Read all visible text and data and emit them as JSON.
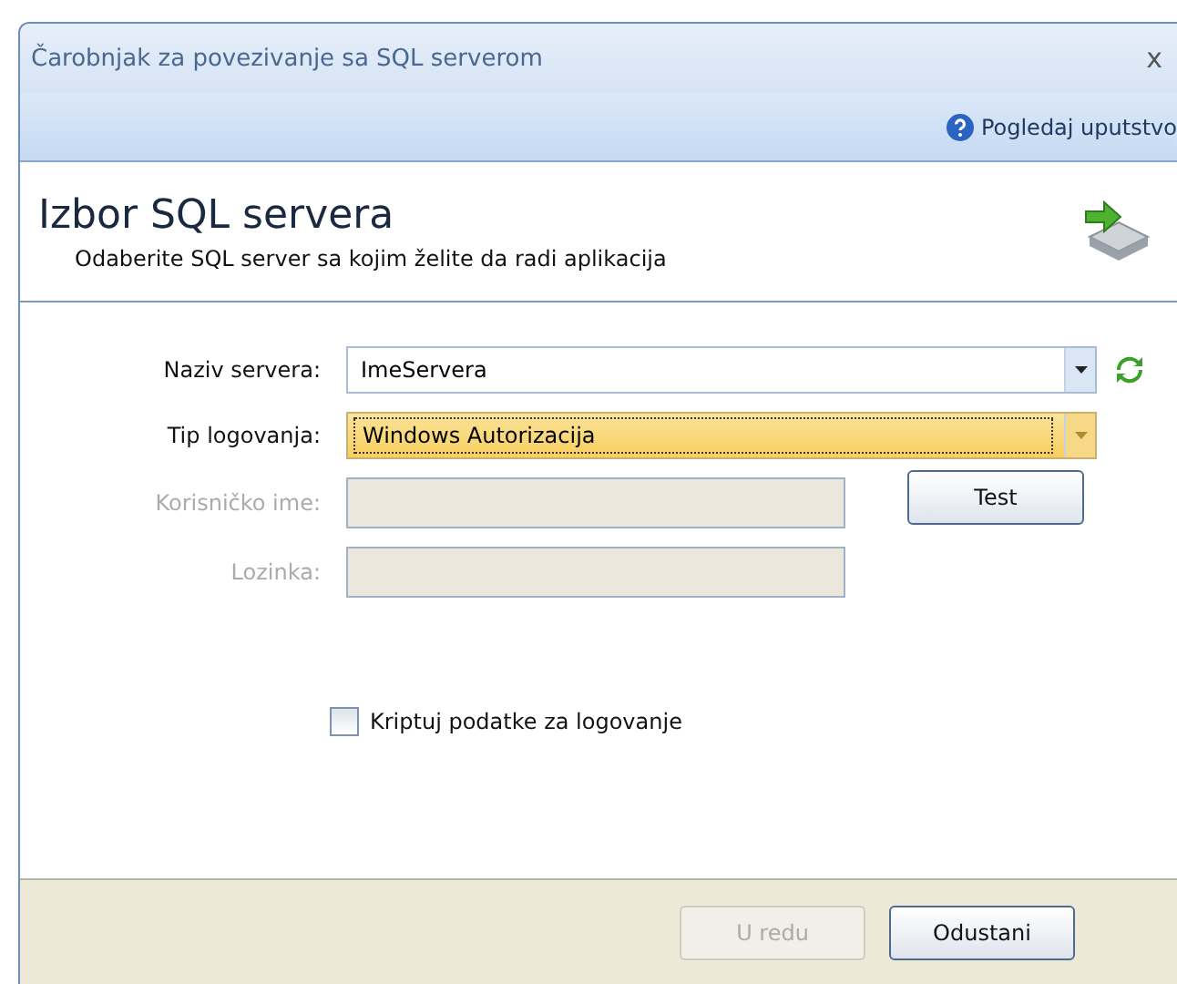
{
  "window": {
    "title": "Čarobnjak za povezivanje sa SQL serverom",
    "close": "x"
  },
  "toolbar": {
    "help_link": "Pogledaj uputstvo"
  },
  "header": {
    "title": "Izbor SQL servera",
    "subtitle": "Odaberite SQL server sa kojim želite da radi aplikacija"
  },
  "fields": [
    {
      "kind": "combo",
      "label": "Naziv servera:",
      "value": "ImeServera",
      "disabled": false,
      "focused": false,
      "refresh": true
    },
    {
      "kind": "combo",
      "label": "Tip logovanja:",
      "value": "Windows Autorizacija",
      "disabled": false,
      "focused": true
    },
    {
      "kind": "text",
      "label": "Korisničko ime:",
      "disabled": true,
      "button": "Test"
    },
    {
      "kind": "text",
      "label": "Lozinka:",
      "disabled": true
    }
  ],
  "checkbox": {
    "label": "Kriptuj podatke za logovanje",
    "checked": false
  },
  "buttons": [
    {
      "label": "U redu",
      "disabled": true
    },
    {
      "label": "Odustani",
      "disabled": false
    }
  ]
}
